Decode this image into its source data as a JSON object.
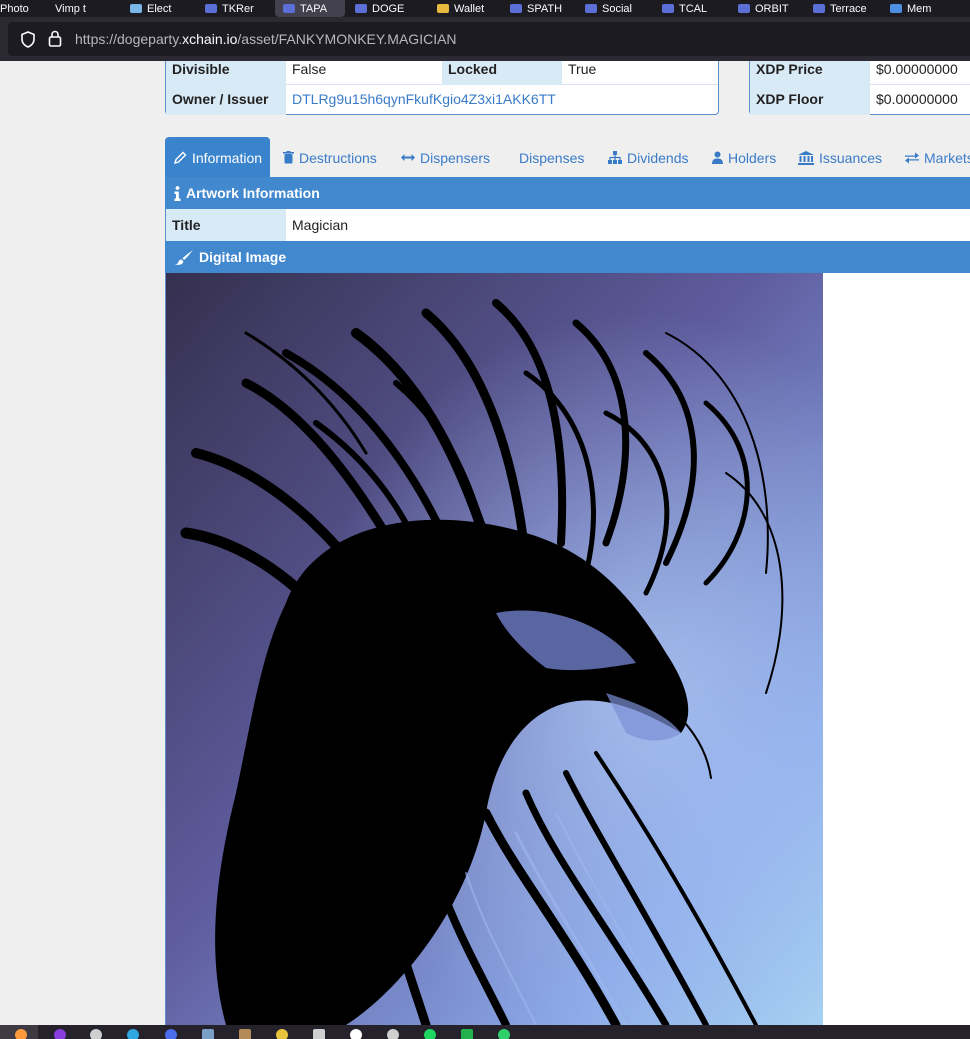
{
  "browser": {
    "tabs": [
      {
        "label": "Photo",
        "color": "#1c1b22",
        "active": false
      },
      {
        "label": "Vimp t",
        "color": "#1c1b22",
        "active": false
      },
      {
        "label": "Elect",
        "color": "#7ab7e8",
        "active": false
      },
      {
        "label": "TKRer",
        "color": "#5b6fd6",
        "active": false
      },
      {
        "label": "TAPA",
        "color": "#5b6fd6",
        "active": true
      },
      {
        "label": "DOGE",
        "color": "#5b6fd6",
        "active": false
      },
      {
        "label": "Wallet",
        "color": "#e8b93d",
        "active": false
      },
      {
        "label": "SPATH",
        "color": "#5b6fd6",
        "active": false
      },
      {
        "label": "Social",
        "color": "#5b6fd6",
        "active": false
      },
      {
        "label": "TCAL",
        "color": "#5b6fd6",
        "active": false
      },
      {
        "label": "ORBIT",
        "color": "#5b6fd6",
        "active": false
      },
      {
        "label": "Terrace",
        "color": "#5b6fd6",
        "active": false
      },
      {
        "label": "Mem",
        "color": "#4d8fe0",
        "active": false
      }
    ],
    "url_prefix": "https://dogeparty.",
    "url_host": "xchain.io",
    "url_path": "/asset/FANKYMONKEY.MAGICIAN"
  },
  "asset_info": {
    "divisible_label": "Divisible",
    "divisible_value": "False",
    "locked_label": "Locked",
    "locked_value": "True",
    "owner_label": "Owner / Issuer",
    "owner_value": "DTLRg9u15h6qynFkufKgio4Z3xi1AKK6TT"
  },
  "price_info": {
    "xdp_price_label": "XDP Price",
    "xdp_price_value": "$0.00000000",
    "xdp_floor_label": "XDP Floor",
    "xdp_floor_value": "$0.00000000"
  },
  "tabs": {
    "information": "Information",
    "destructions": "Destructions",
    "dispensers": "Dispensers",
    "dispenses": "Dispenses",
    "dividends": "Dividends",
    "holders": "Holders",
    "issuances": "Issuances",
    "markets": "Markets"
  },
  "artwork": {
    "header": "Artwork Information",
    "title_label": "Title",
    "title_value": "Magician"
  },
  "digital_image": {
    "header": "Digital Image"
  },
  "colors": {
    "accent": "#4188cf",
    "link": "#3a7bc8",
    "label_bg": "#d9eaf7"
  },
  "taskbar": {
    "icons": [
      {
        "name": "firefox-icon",
        "color": "#ff9a3c"
      },
      {
        "name": "app-icon",
        "color": "#8a3ee0"
      },
      {
        "name": "whatsapp-icon",
        "color": "#cfcfcf"
      },
      {
        "name": "telegram-icon",
        "color": "#2ea6e0"
      },
      {
        "name": "signal-icon",
        "color": "#4a6df0"
      },
      {
        "name": "notes-icon",
        "color": "#7aa0c8"
      },
      {
        "name": "folder-icon",
        "color": "#b58a5a"
      },
      {
        "name": "photos-icon",
        "color": "#e8c43d"
      },
      {
        "name": "document-icon",
        "color": "#cfcfcf"
      },
      {
        "name": "github-icon",
        "color": "#ffffff"
      },
      {
        "name": "at-icon",
        "color": "#cfcfcf"
      },
      {
        "name": "spotify-icon",
        "color": "#1ed760"
      },
      {
        "name": "xbox-icon",
        "color": "#22b14c"
      },
      {
        "name": "chat-icon",
        "color": "#2fcf6a"
      }
    ]
  }
}
